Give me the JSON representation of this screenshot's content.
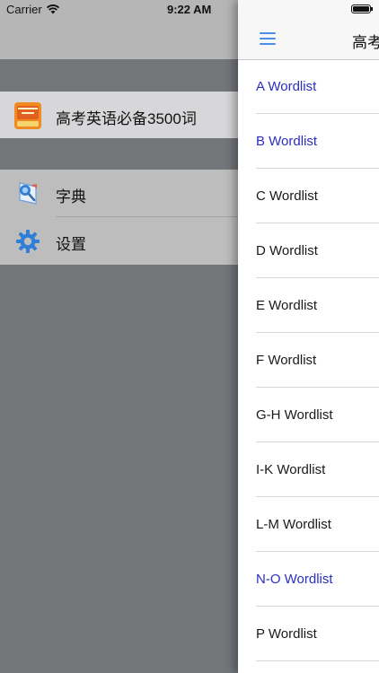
{
  "status_bar": {
    "carrier": "Carrier",
    "time": "9:22 AM"
  },
  "menu": {
    "book": {
      "label": "高考英语必备3500词",
      "icon": "book-cover-icon"
    },
    "items": [
      {
        "label": "字典",
        "icon": "dictionary-icon"
      },
      {
        "label": "设置",
        "icon": "gear-icon"
      }
    ]
  },
  "panel": {
    "title": "高考",
    "wordlists": [
      {
        "label": "A Wordlist",
        "highlighted": true
      },
      {
        "label": "B Wordlist",
        "highlighted": true
      },
      {
        "label": "C Wordlist",
        "highlighted": false
      },
      {
        "label": "D Wordlist",
        "highlighted": false
      },
      {
        "label": "E Wordlist",
        "highlighted": false
      },
      {
        "label": "F Wordlist",
        "highlighted": false
      },
      {
        "label": "G-H Wordlist",
        "highlighted": false
      },
      {
        "label": "I-K Wordlist",
        "highlighted": false
      },
      {
        "label": "L-M Wordlist",
        "highlighted": false
      },
      {
        "label": "N-O Wordlist",
        "highlighted": true
      },
      {
        "label": "P Wordlist",
        "highlighted": false
      }
    ]
  },
  "colors": {
    "link_blue": "#2a2ec2",
    "accent_blue": "#4a8fe2"
  }
}
